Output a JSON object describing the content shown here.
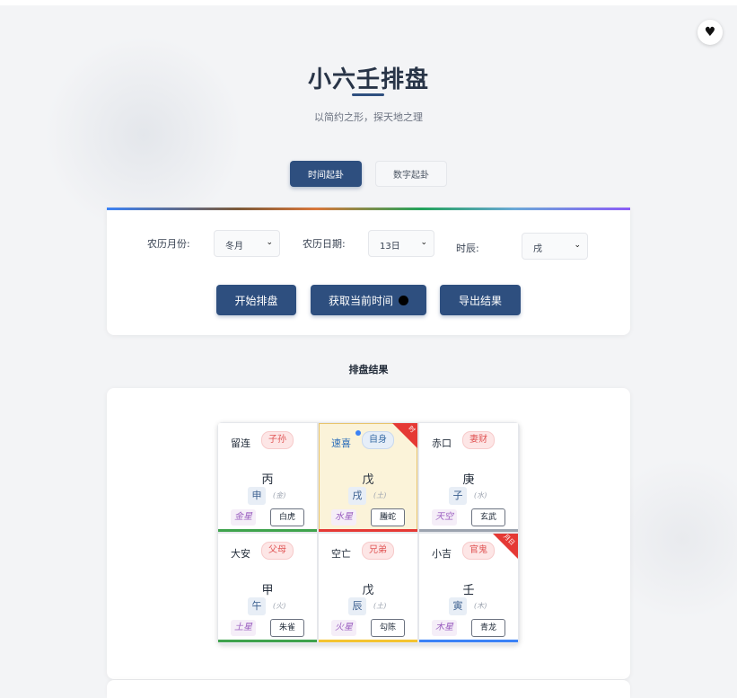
{
  "header": {
    "title": "小六壬排盘",
    "subtitle": "以简约之形，探天地之理",
    "like_icon": "♥"
  },
  "tabs": [
    {
      "label": "时间起卦",
      "active": true
    },
    {
      "label": "数字起卦",
      "active": false
    }
  ],
  "form": {
    "month_label": "农历月份:",
    "month_value": "冬月",
    "day_label": "农历日期:",
    "day_value": "13日",
    "hour_label": "时辰:",
    "hour_value": "戌",
    "buttons": {
      "start": "开始排盘",
      "now": "获取当前时间",
      "export": "导出结果"
    }
  },
  "result": {
    "section_title": "排盘结果",
    "cells": [
      {
        "palace": "留连",
        "relation": "子孙",
        "stem": "丙",
        "branch": "申",
        "element": "(金)",
        "star": "金星",
        "god": "白虎"
      },
      {
        "palace": "速喜",
        "relation": "自身",
        "stem": "戊",
        "branch": "戌",
        "element": "(土)",
        "star": "水星",
        "god": "螣蛇",
        "corner": "时"
      },
      {
        "palace": "赤口",
        "relation": "妻财",
        "stem": "庚",
        "branch": "子",
        "element": "(水)",
        "star": "天空",
        "god": "玄武"
      },
      {
        "palace": "大安",
        "relation": "父母",
        "stem": "甲",
        "branch": "午",
        "element": "(火)",
        "star": "土星",
        "god": "朱雀"
      },
      {
        "palace": "空亡",
        "relation": "兄弟",
        "stem": "戊",
        "branch": "辰",
        "element": "(土)",
        "star": "火星",
        "god": "勾陈"
      },
      {
        "palace": "小吉",
        "relation": "官鬼",
        "stem": "壬",
        "branch": "寅",
        "element": "(木)",
        "star": "木星",
        "god": "青龙",
        "corner": "月日"
      }
    ]
  },
  "colors": {
    "primary": "#2e4f7f",
    "highlight": "#fbf3d9",
    "corner_badge": "#e53935",
    "stripe_green": "#3fa34d",
    "stripe_red": "#e53935",
    "stripe_gray": "#9ca3af",
    "stripe_yellow": "#f4c430",
    "stripe_blue": "#3b82f6"
  }
}
